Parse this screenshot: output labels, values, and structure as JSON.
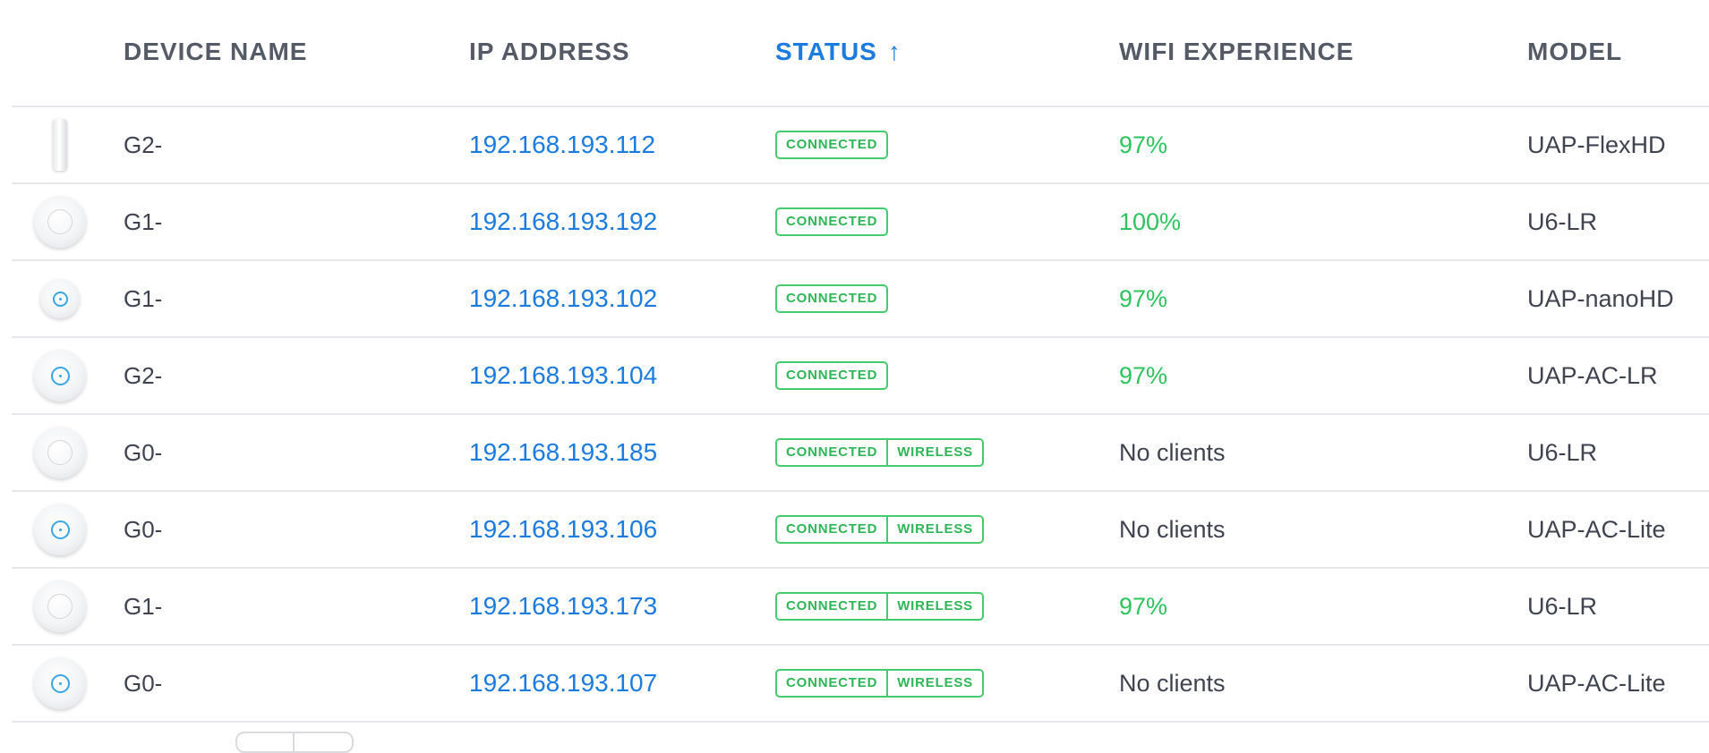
{
  "columns": {
    "device_name": "DEVICE NAME",
    "ip_address": "IP ADDRESS",
    "status": "STATUS",
    "status_sort_icon": "↑",
    "wifi_experience": "WIFI EXPERIENCE",
    "model": "MODEL"
  },
  "rows": [
    {
      "icon": "flex-device-icon",
      "name": "G2-",
      "ip": "192.168.193.112",
      "status": [
        "CONNECTED"
      ],
      "wifi": "97%",
      "wifi_good": true,
      "model": "UAP-FlexHD"
    },
    {
      "icon": "u6-lr-device-icon",
      "name": "G1-",
      "ip": "192.168.193.192",
      "status": [
        "CONNECTED"
      ],
      "wifi": "100%",
      "wifi_good": true,
      "model": "U6-LR"
    },
    {
      "icon": "nanohd-device-icon",
      "name": "G1-",
      "ip": "192.168.193.102",
      "status": [
        "CONNECTED"
      ],
      "wifi": "97%",
      "wifi_good": true,
      "model": "UAP-nanoHD"
    },
    {
      "icon": "ac-lr-device-icon",
      "name": "G2-",
      "ip": "192.168.193.104",
      "status": [
        "CONNECTED"
      ],
      "wifi": "97%",
      "wifi_good": true,
      "model": "UAP-AC-LR"
    },
    {
      "icon": "u6-lr-device-icon",
      "name": "G0-",
      "ip": "192.168.193.185",
      "status": [
        "CONNECTED",
        "WIRELESS"
      ],
      "wifi": "No clients",
      "wifi_good": false,
      "model": "U6-LR"
    },
    {
      "icon": "ac-lite-device-icon",
      "name": "G0-",
      "ip": "192.168.193.106",
      "status": [
        "CONNECTED",
        "WIRELESS"
      ],
      "wifi": "No clients",
      "wifi_good": false,
      "model": "UAP-AC-Lite"
    },
    {
      "icon": "u6-lr-device-icon",
      "name": "G1-",
      "ip": "192.168.193.173",
      "status": [
        "CONNECTED",
        "WIRELESS"
      ],
      "wifi": "97%",
      "wifi_good": true,
      "model": "U6-LR"
    },
    {
      "icon": "ac-lite-device-icon",
      "name": "G0-",
      "ip": "192.168.193.107",
      "status": [
        "CONNECTED",
        "WIRELESS"
      ],
      "wifi": "No clients",
      "wifi_good": false,
      "model": "UAP-AC-Lite"
    }
  ],
  "colors": {
    "link": "#1b7be0",
    "status_green": "#2fb656",
    "wifi_good": "#2ec45d"
  }
}
